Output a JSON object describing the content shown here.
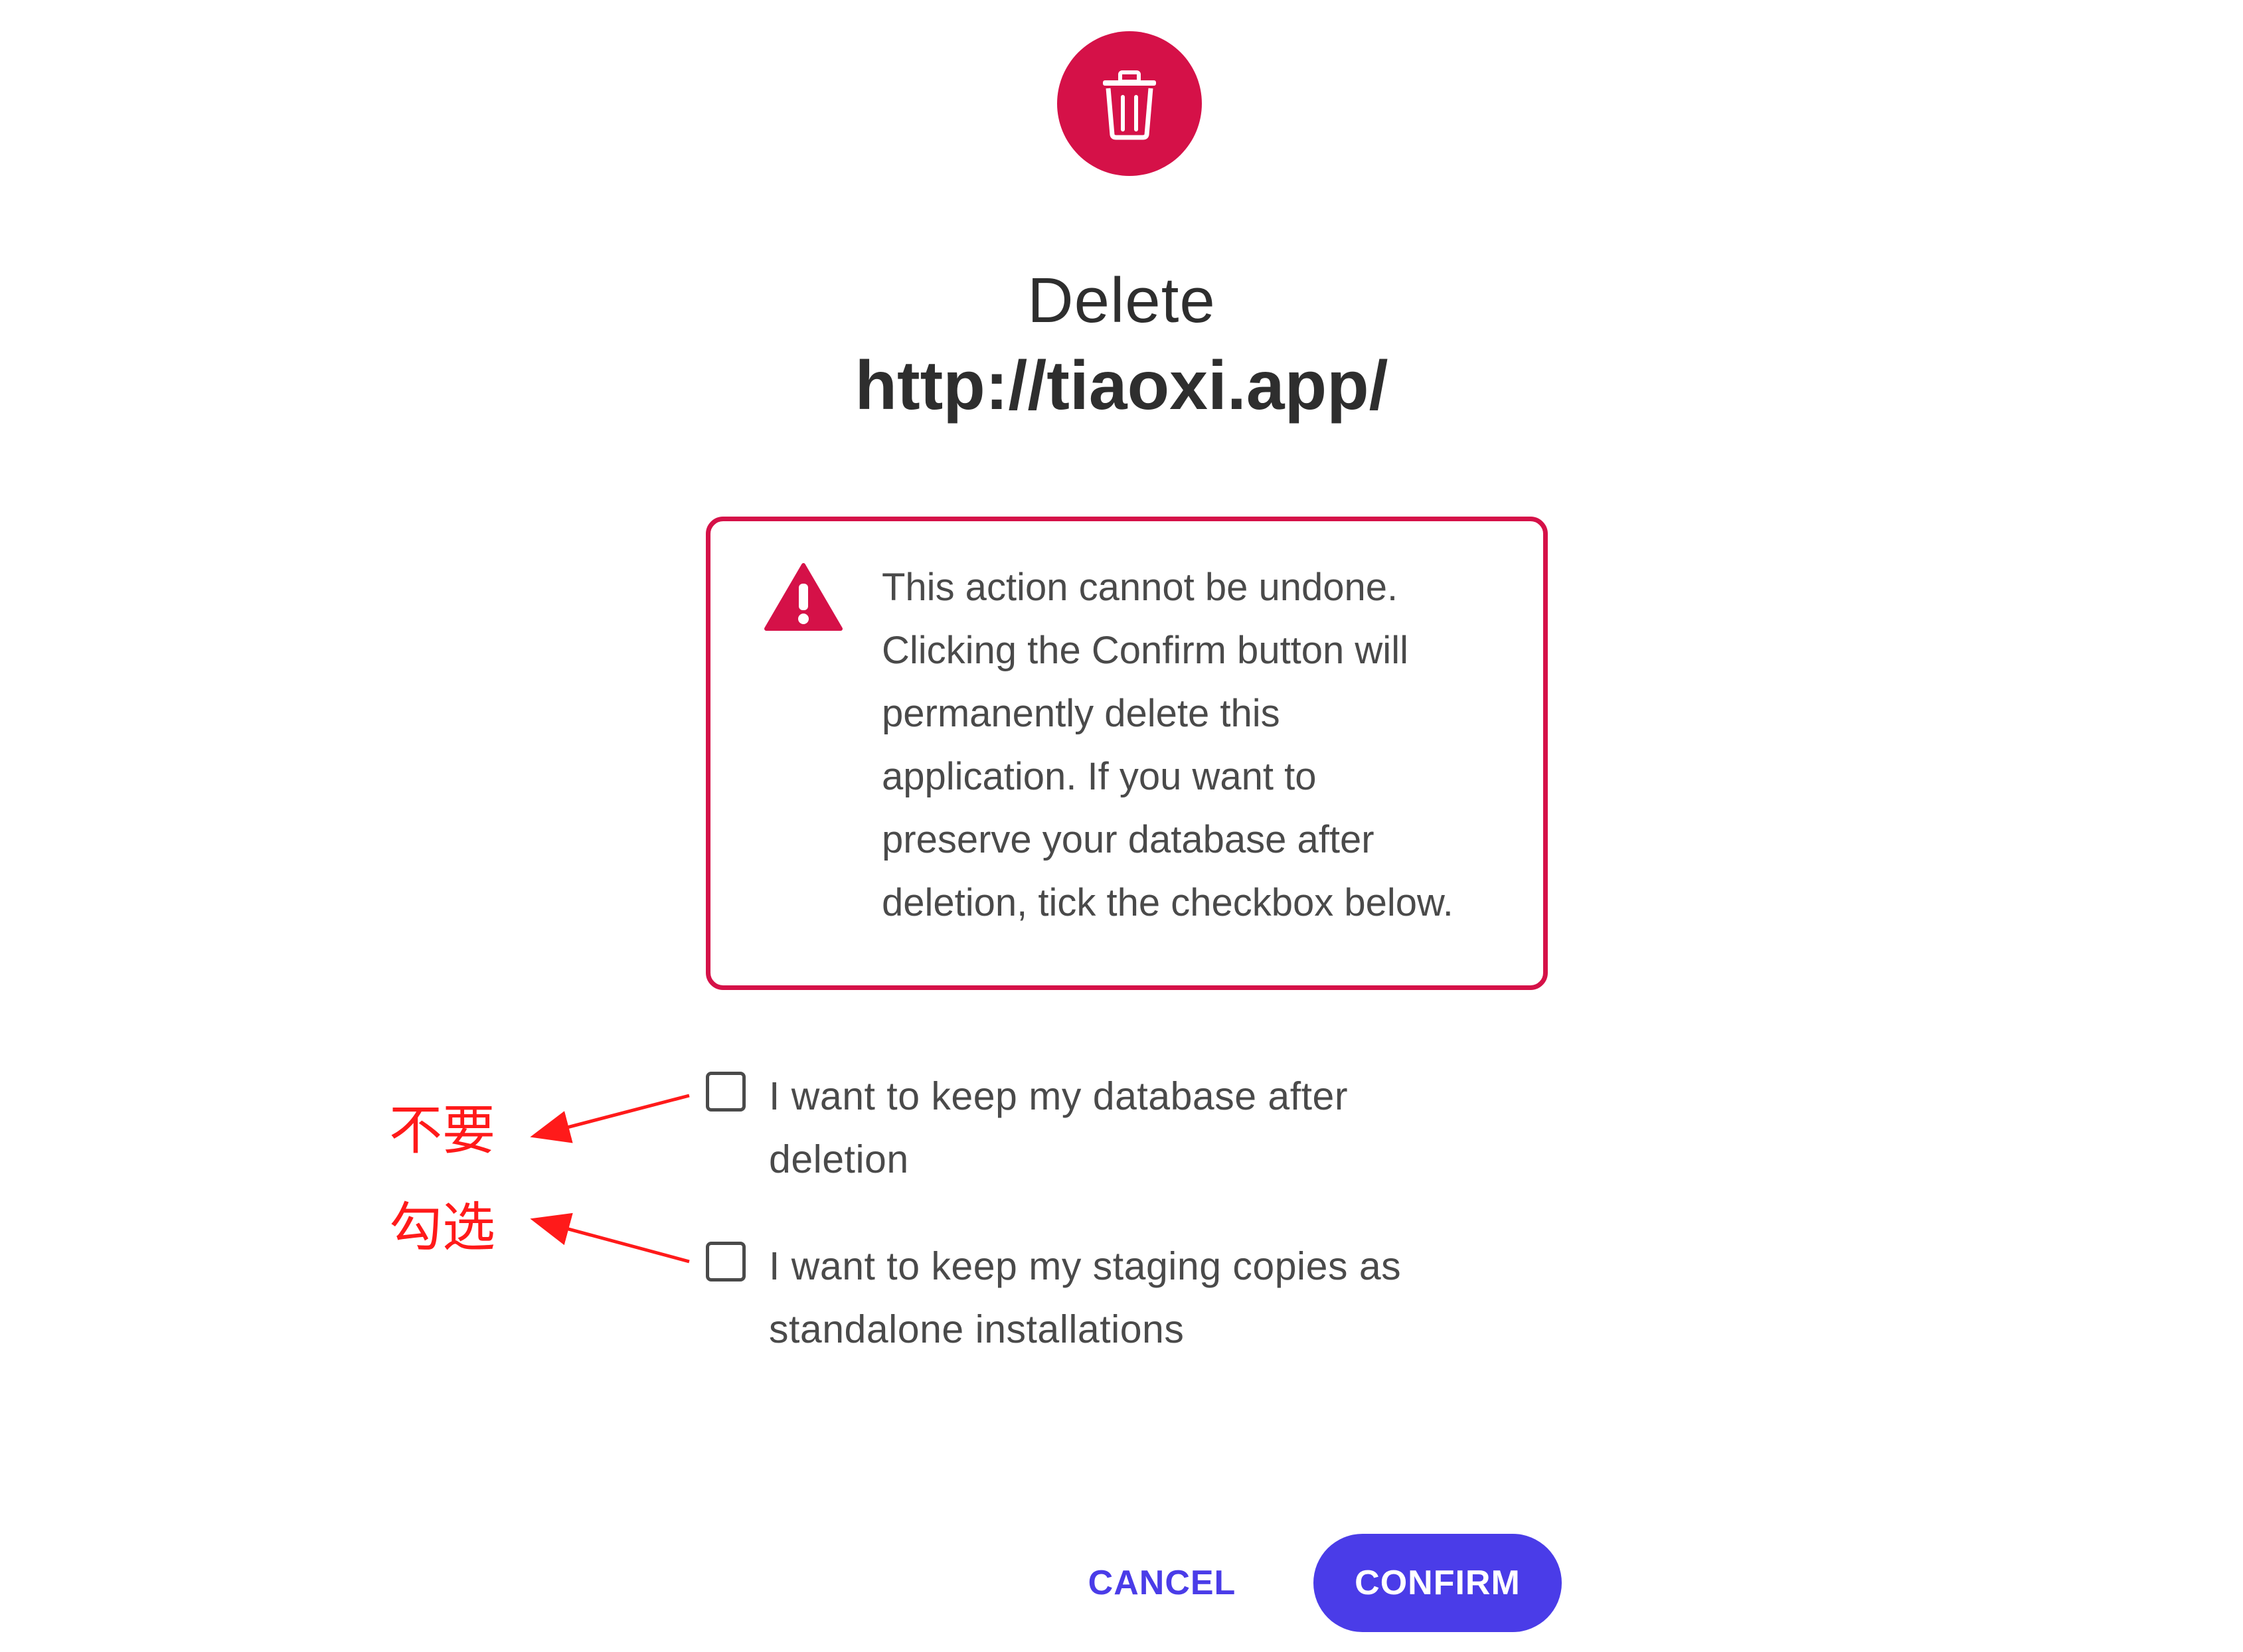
{
  "dialog": {
    "title_line1": "Delete",
    "title_line2": "http://tiaoxi.app/",
    "icon": "trash-icon",
    "accent_color": "#d51148"
  },
  "warning": {
    "icon": "warning-triangle-icon",
    "lines": [
      "This action cannot be undone.",
      "Clicking the Confirm button will",
      "permanently delete this",
      "application. If you want to",
      "preserve your database after",
      "deletion, tick the checkbox below."
    ]
  },
  "options": [
    {
      "label_line1": "I want to keep my database after",
      "label_line2": "deletion",
      "checked": false
    },
    {
      "label_line1": "I want to keep my staging copies as",
      "label_line2": "standalone installations",
      "checked": false
    }
  ],
  "annotations": {
    "text1": "不要",
    "text2": "勾选",
    "color": "#ff1a1a"
  },
  "buttons": {
    "cancel_label": "CANCEL",
    "confirm_label": "CONFIRM",
    "primary_color": "#4a3ce8"
  }
}
